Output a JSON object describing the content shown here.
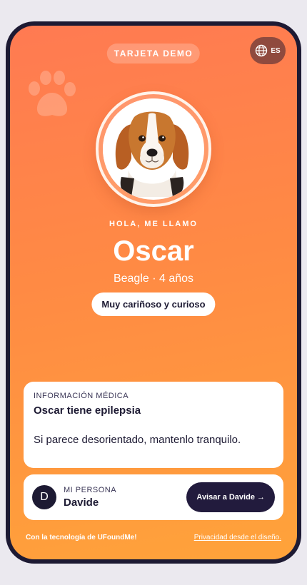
{
  "header": {
    "demo_label": "TARJETA DEMO",
    "language_code": "ES",
    "language_icon": "globe-icon"
  },
  "pet": {
    "greeting": "HOLA, ME LLAMO",
    "name": "Oscar",
    "subtitle": "Beagle · 4 años",
    "trait": "Muy cariñoso y curioso",
    "photo_icon": "beagle-photo"
  },
  "medical": {
    "label": "INFORMACIÓN MÉDICA",
    "title": "Oscar tiene epilepsia",
    "instructions": "Si parece desorientado, mantenlo tranquilo."
  },
  "contact": {
    "initial": "D",
    "label": "MI PERSONA",
    "name": "Davide",
    "alert_button": "Avisar a Davide →"
  },
  "footer": {
    "powered_by": "Con la tecnología de UFoundMe!",
    "privacy_link": "Privacidad desde el diseño."
  },
  "colors": {
    "gradient_top": "#ff7a52",
    "gradient_bottom": "#ffa33a",
    "dark": "#1d1a33",
    "language_button": "#8f4a3e"
  }
}
